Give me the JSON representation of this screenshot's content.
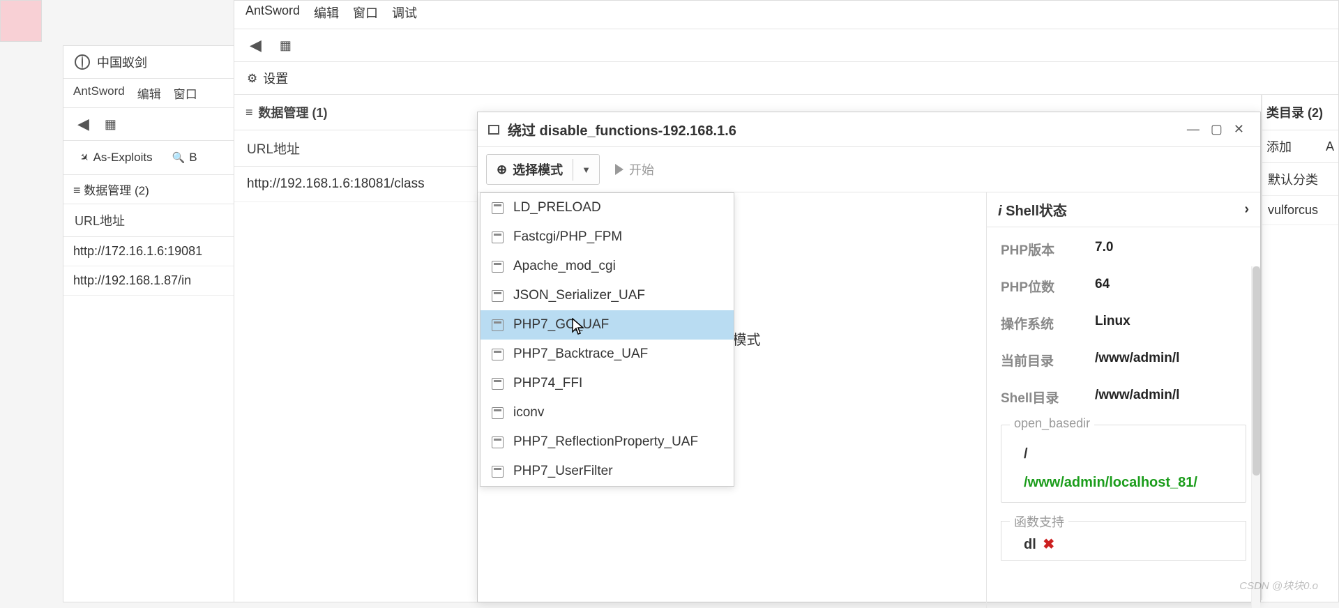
{
  "watermark": "CSDN @块块0.o",
  "bg": {
    "title": "中国蚁剑",
    "menu": [
      "AntSword",
      "编辑",
      "窗口"
    ],
    "tabs": {
      "as_exploits": "As-Exploits",
      "b": "B"
    },
    "data_hdr": "数据管理 (2)",
    "url_label": "URL地址",
    "rows": [
      "http://172.16.1.6:19081",
      "http://192.168.1.87/in"
    ]
  },
  "main": {
    "menu": [
      "AntSword",
      "编辑",
      "窗口",
      "调试"
    ],
    "settings_label": "设置",
    "data_hdr": "数据管理 (1)",
    "url_label": "URL地址",
    "rows": [
      "http://192.168.1.6:18081/class"
    ],
    "cat_hdr": "类目录 (2)",
    "cat_add": "添加",
    "cat_a": "A",
    "cat_items": [
      "默认分类",
      "vulforcus"
    ]
  },
  "modal": {
    "title": "绕过 disable_functions-192.168.1.6",
    "btn_select": "选择模式",
    "btn_start": "开始",
    "hint": "钮,选择模式",
    "dropdown": [
      "LD_PRELOAD",
      "Fastcgi/PHP_FPM",
      "Apache_mod_cgi",
      "JSON_Serializer_UAF",
      "PHP7_GC_UAF",
      "PHP7_Backtrace_UAF",
      "PHP74_FFI",
      "iconv",
      "PHP7_ReflectionProperty_UAF",
      "PHP7_UserFilter"
    ],
    "dropdown_selected_index": 4,
    "shell_hdr": "Shell状态",
    "info": {
      "php_ver_lbl": "PHP版本",
      "php_ver": "7.0",
      "php_bits_lbl": "PHP位数",
      "php_bits": "64",
      "os_lbl": "操作系统",
      "os": "Linux",
      "cwd_lbl": "当前目录",
      "cwd": "/www/admin/l",
      "shell_dir_lbl": "Shell目录",
      "shell_dir": "/www/admin/l"
    },
    "open_basedir": {
      "legend": "open_basedir",
      "slash": "/",
      "path": "/www/admin/localhost_81/"
    },
    "func_support": {
      "legend": "函数支持",
      "fn": "dl",
      "mark": "✖"
    }
  }
}
